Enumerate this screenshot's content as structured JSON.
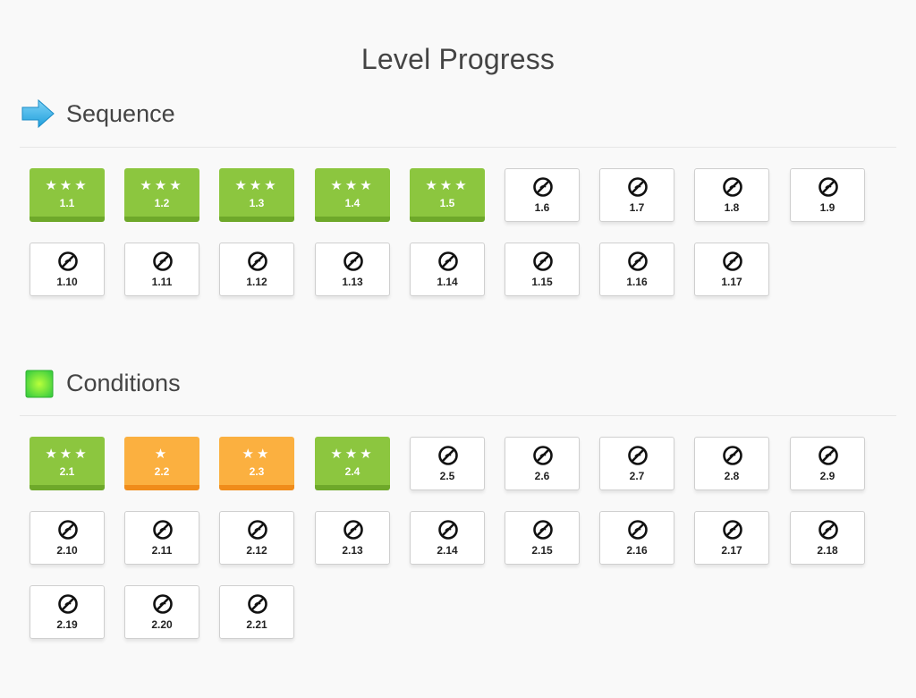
{
  "title": "Level Progress",
  "colors": {
    "completed": "#8cc63f",
    "partial": "#fbb040",
    "locked": "#ffffff"
  },
  "sections": [
    {
      "label": "Sequence",
      "icon": "arrow-right-icon",
      "levels": [
        {
          "label": "1.1",
          "state": "completed",
          "stars": 3
        },
        {
          "label": "1.2",
          "state": "completed",
          "stars": 3
        },
        {
          "label": "1.3",
          "state": "completed",
          "stars": 3
        },
        {
          "label": "1.4",
          "state": "completed",
          "stars": 3
        },
        {
          "label": "1.5",
          "state": "completed",
          "stars": 3
        },
        {
          "label": "1.6",
          "state": "locked",
          "stars": 0
        },
        {
          "label": "1.7",
          "state": "locked",
          "stars": 0
        },
        {
          "label": "1.8",
          "state": "locked",
          "stars": 0
        },
        {
          "label": "1.9",
          "state": "locked",
          "stars": 0
        },
        {
          "label": "1.10",
          "state": "locked",
          "stars": 0
        },
        {
          "label": "1.11",
          "state": "locked",
          "stars": 0
        },
        {
          "label": "1.12",
          "state": "locked",
          "stars": 0
        },
        {
          "label": "1.13",
          "state": "locked",
          "stars": 0
        },
        {
          "label": "1.14",
          "state": "locked",
          "stars": 0
        },
        {
          "label": "1.15",
          "state": "locked",
          "stars": 0
        },
        {
          "label": "1.16",
          "state": "locked",
          "stars": 0
        },
        {
          "label": "1.17",
          "state": "locked",
          "stars": 0
        }
      ]
    },
    {
      "label": "Conditions",
      "icon": "green-square-icon",
      "levels": [
        {
          "label": "2.1",
          "state": "completed",
          "stars": 3
        },
        {
          "label": "2.2",
          "state": "partial",
          "stars": 1
        },
        {
          "label": "2.3",
          "state": "partial",
          "stars": 2
        },
        {
          "label": "2.4",
          "state": "completed",
          "stars": 3
        },
        {
          "label": "2.5",
          "state": "locked",
          "stars": 0
        },
        {
          "label": "2.6",
          "state": "locked",
          "stars": 0
        },
        {
          "label": "2.7",
          "state": "locked",
          "stars": 0
        },
        {
          "label": "2.8",
          "state": "locked",
          "stars": 0
        },
        {
          "label": "2.9",
          "state": "locked",
          "stars": 0
        },
        {
          "label": "2.10",
          "state": "locked",
          "stars": 0
        },
        {
          "label": "2.11",
          "state": "locked",
          "stars": 0
        },
        {
          "label": "2.12",
          "state": "locked",
          "stars": 0
        },
        {
          "label": "2.13",
          "state": "locked",
          "stars": 0
        },
        {
          "label": "2.14",
          "state": "locked",
          "stars": 0
        },
        {
          "label": "2.15",
          "state": "locked",
          "stars": 0
        },
        {
          "label": "2.16",
          "state": "locked",
          "stars": 0
        },
        {
          "label": "2.17",
          "state": "locked",
          "stars": 0
        },
        {
          "label": "2.18",
          "state": "locked",
          "stars": 0
        },
        {
          "label": "2.19",
          "state": "locked",
          "stars": 0
        },
        {
          "label": "2.20",
          "state": "locked",
          "stars": 0
        },
        {
          "label": "2.21",
          "state": "locked",
          "stars": 0
        }
      ]
    }
  ]
}
